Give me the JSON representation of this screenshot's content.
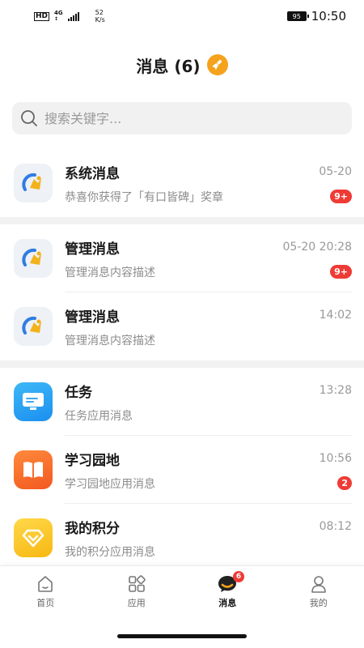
{
  "status_bar": {
    "hd": "HD",
    "net_type": "4G",
    "speed_value": "52",
    "speed_unit": "K/s",
    "battery": "95",
    "time": "10:50"
  },
  "header": {
    "title": "消息 (6)",
    "clear_icon": "broom-icon",
    "accent_color": "#f5a21c"
  },
  "search": {
    "placeholder": "搜索关键字..."
  },
  "groups": [
    {
      "items": [
        {
          "name": "系统消息",
          "desc": "恭喜你获得了「有口皆碑」奖章",
          "time": "05-20",
          "badge": "9+",
          "icon": "system-logo-icon"
        }
      ]
    },
    {
      "items": [
        {
          "name": "管理消息",
          "desc": "管理消息内容描述",
          "time": "05-20 20:28",
          "badge": "9+",
          "icon": "system-logo-icon"
        },
        {
          "name": "管理消息",
          "desc": "管理消息内容描述",
          "time": "14:02",
          "badge": "",
          "icon": "system-logo-icon"
        }
      ]
    },
    {
      "items": [
        {
          "name": "任务",
          "desc": "任务应用消息",
          "time": "13:28",
          "badge": "",
          "icon": "task-monitor-icon"
        },
        {
          "name": "学习园地",
          "desc": "学习园地应用消息",
          "time": "10:56",
          "badge": "2",
          "icon": "open-book-icon"
        },
        {
          "name": "我的积分",
          "desc": "我的积分应用消息",
          "time": "08:12",
          "badge": "",
          "icon": "diamond-icon"
        }
      ]
    }
  ],
  "tabbar": {
    "tabs": [
      {
        "label": "首页",
        "icon": "home-icon"
      },
      {
        "label": "应用",
        "icon": "apps-grid-icon"
      },
      {
        "label": "消息",
        "icon": "chat-bubble-icon",
        "badge": "6",
        "active": true
      },
      {
        "label": "我的",
        "icon": "person-icon"
      }
    ]
  },
  "colors": {
    "badge_red": "#ef3b35",
    "task_blue": "#1b8ff0",
    "study_orange": "#f2581f",
    "points_yellow": "#f7b812"
  }
}
